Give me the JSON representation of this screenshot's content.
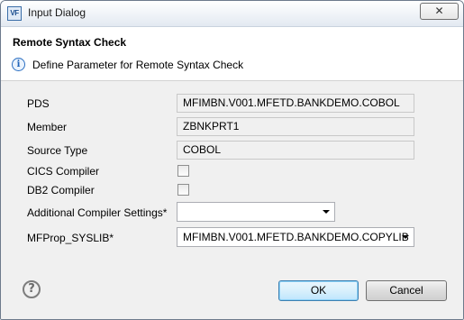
{
  "window": {
    "title": "Input Dialog",
    "icon_text": "VF",
    "close_glyph": "✕"
  },
  "header": {
    "title": "Remote Syntax Check",
    "message": "Define Parameter for Remote Syntax Check",
    "info_glyph": "i"
  },
  "form": {
    "pds_label": "PDS",
    "pds_value": "MFIMBN.V001.MFETD.BANKDEMO.COBOL",
    "member_label": "Member",
    "member_value": "ZBNKPRT1",
    "source_type_label": "Source Type",
    "source_type_value": "COBOL",
    "cics_label": "CICS Compiler",
    "cics_checked": false,
    "db2_label": "DB2 Compiler",
    "db2_checked": false,
    "additional_label": "Additional Compiler Settings*",
    "additional_value": "",
    "syslib_label": "MFProp_SYSLIB*",
    "syslib_value": "MFIMBN.V001.MFETD.BANKDEMO.COPYLIB"
  },
  "footer": {
    "help_glyph": "?",
    "ok_label": "OK",
    "cancel_label": "Cancel"
  }
}
